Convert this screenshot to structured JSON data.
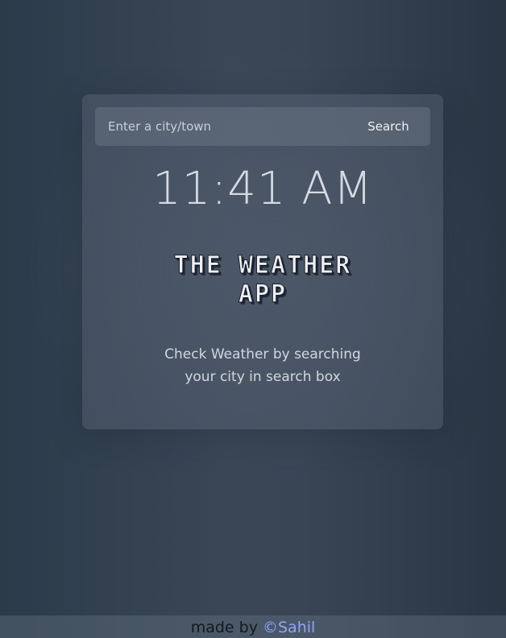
{
  "search": {
    "placeholder": "Enter a city/town",
    "value": "",
    "button_label": "Search"
  },
  "clock": {
    "time": "11:41 AM"
  },
  "app": {
    "title": "The Weather App",
    "subtitle": "Check Weather by searching your city in search box"
  },
  "footer": {
    "made_by_text": "made by",
    "author_link": "©Sahil"
  },
  "colors": {
    "background": "#343f4e",
    "card": "#4a5565",
    "link": "#8fa3ff",
    "text": "#d5dae3"
  }
}
